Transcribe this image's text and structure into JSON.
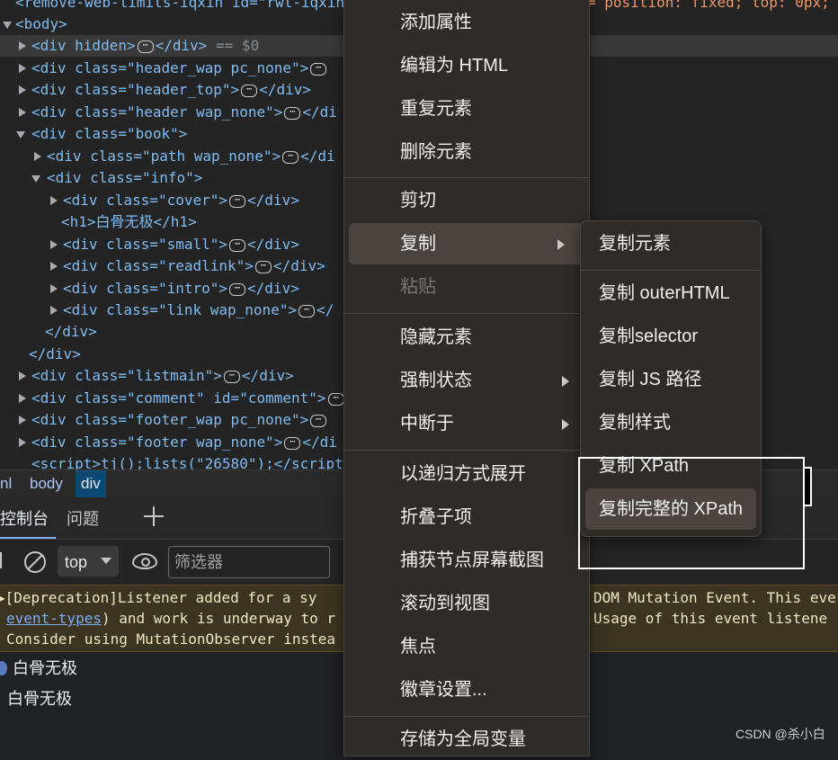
{
  "elements_tree": {
    "lines": [
      {
        "text": "<remove-web-limits-iqxin id=\"rwl-iqxin\"",
        "tail": "= position: fixed; top: 0px;"
      },
      {
        "text": "<body>"
      },
      {
        "text": "<div hidden>",
        "close": "</div>",
        "suffix": "== $0"
      },
      {
        "text": "<div class=\"header_wap pc_none\">"
      },
      {
        "text": "<div class=\"header_top\">",
        "close": "</div>"
      },
      {
        "text": "<div class=\"header wap_none\">",
        "close": "</di"
      },
      {
        "text": "<div class=\"book\">"
      },
      {
        "text": "<div class=\"path wap_none\">",
        "close": "</di"
      },
      {
        "text": "<div class=\"info\">"
      },
      {
        "text": "<div class=\"cover\">",
        "close": "</div>"
      },
      {
        "text": "<h1>白骨无极</h1>"
      },
      {
        "text": "<div class=\"small\">",
        "close": "</div>"
      },
      {
        "text": "<div class=\"readlink\">",
        "close": "</div>"
      },
      {
        "text": "<div class=\"intro\">",
        "close": "</div>"
      },
      {
        "text": "<div class=\"link wap_none\">",
        "close": "</"
      },
      {
        "text": "</div>"
      },
      {
        "text": "</div>"
      },
      {
        "text": "<div class=\"listmain\">",
        "close": "</div>"
      },
      {
        "text": "<div class=\"comment\" id=\"comment\">"
      },
      {
        "text": "<div class=\"footer_wap pc_none\">"
      },
      {
        "text": "<div class=\"footer wap_none\">",
        "close": "</di"
      },
      {
        "text": "<script>tj();lists(\"26580\");</script"
      }
    ]
  },
  "breadcrumbs": [
    "nl",
    "body",
    "div"
  ],
  "drawer_tabs": {
    "console": "控制台",
    "issues": "问题"
  },
  "console_toolbar": {
    "context": "top",
    "filter_placeholder": "筛选器"
  },
  "warning": {
    "line1_left": "▶[Deprecation]Listener added for a sy",
    "line1_right": "DOM Mutation Event. This eve",
    "line2_link": "event-types",
    "line2_left": ") and work is underway to r",
    "line2_right": "Usage of this event listene",
    "line3_left": "Consider using MutationObserver instea"
  },
  "logs": [
    "白骨无极",
    "白骨无极"
  ],
  "context_menu": {
    "items": [
      "添加属性",
      "编辑为 HTML",
      "重复元素",
      "删除元素",
      "剪切",
      "复制",
      "粘贴",
      "隐藏元素",
      "强制状态",
      "中断于",
      "以递归方式展开",
      "折叠子项",
      "捕获节点屏幕截图",
      "滚动到视图",
      "焦点",
      "徽章设置...",
      "存储为全局变量"
    ]
  },
  "submenu": {
    "items": [
      "复制元素",
      "复制 outerHTML",
      "复制selector",
      "复制 JS 路径",
      "复制样式",
      "复制 XPath",
      "复制完整的 XPath"
    ]
  },
  "watermark": "CSDN @杀小白"
}
